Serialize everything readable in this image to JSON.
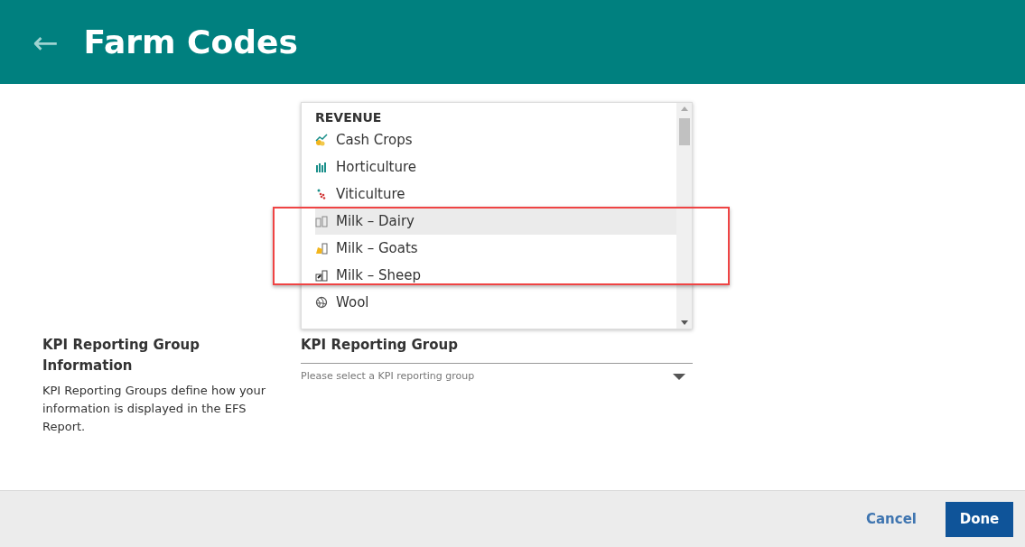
{
  "header": {
    "back": "←",
    "title": "Farm Codes"
  },
  "tag_list": {
    "group": "REVENUE",
    "items": [
      {
        "label": "Cash Crops",
        "kind": "chart",
        "highlighted": false
      },
      {
        "label": "Horticulture",
        "kind": "plants",
        "highlighted": false
      },
      {
        "label": "Viticulture",
        "kind": "grapes",
        "highlighted": false
      },
      {
        "label": "Milk – Dairy",
        "kind": "bottles",
        "highlighted": true
      },
      {
        "label": "Milk – Goats",
        "kind": "goat",
        "highlighted": false
      },
      {
        "label": "Milk – Sheep",
        "kind": "sheep",
        "highlighted": false
      },
      {
        "label": "Wool",
        "kind": "yarn",
        "highlighted": false
      }
    ]
  },
  "kpi_info": {
    "title": "KPI Reporting Group Information",
    "description": "KPI Reporting Groups define how your information is displayed in the EFS Report."
  },
  "kpi_field": {
    "label": "KPI Reporting Group",
    "placeholder": "Please select a KPI reporting group"
  },
  "footer": {
    "buttons": [
      {
        "label": "Cancel",
        "kind": "link"
      },
      {
        "label": "Done",
        "kind": "primary"
      }
    ]
  }
}
